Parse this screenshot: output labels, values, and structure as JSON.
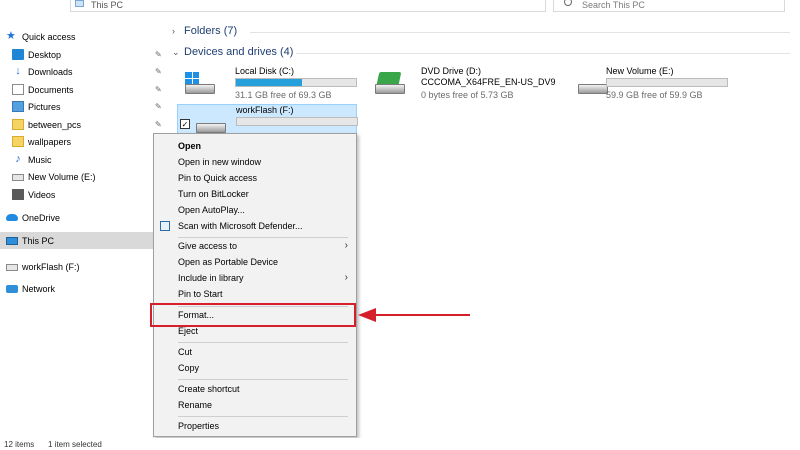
{
  "address": {
    "path": "This PC"
  },
  "search": {
    "placeholder": "Search This PC"
  },
  "nav": {
    "items": [
      {
        "label": "Quick access",
        "icon": "star-icon",
        "pinned": false
      },
      {
        "label": "Desktop",
        "icon": "desktop-icon",
        "pinned": true
      },
      {
        "label": "Downloads",
        "icon": "download-icon",
        "pinned": true
      },
      {
        "label": "Documents",
        "icon": "document-icon",
        "pinned": true
      },
      {
        "label": "Pictures",
        "icon": "pictures-icon",
        "pinned": true
      },
      {
        "label": "between_pcs",
        "icon": "folder-icon",
        "pinned": true
      },
      {
        "label": "wallpapers",
        "icon": "folder-icon",
        "pinned": false
      },
      {
        "label": "Music",
        "icon": "music-icon",
        "pinned": false
      },
      {
        "label": "New Volume (E:)",
        "icon": "drive-icon",
        "pinned": false
      },
      {
        "label": "Videos",
        "icon": "video-icon",
        "pinned": false
      },
      {
        "label": "OneDrive",
        "icon": "cloud-icon",
        "pinned": false
      },
      {
        "label": "This PC",
        "icon": "computer-icon",
        "pinned": false
      },
      {
        "label": "workFlash (F:)",
        "icon": "usb-drive-icon",
        "pinned": false
      },
      {
        "label": "Network",
        "icon": "network-icon",
        "pinned": false
      }
    ]
  },
  "content": {
    "folders_header": "Folders (7)",
    "devices_header": "Devices and drives (4)",
    "drives": [
      {
        "name": "Local Disk (C:)",
        "free": "31.1 GB free of 69.3 GB",
        "used_fraction": 0.55
      },
      {
        "name": "DVD Drive (D:)",
        "label2": "CCCOMA_X64FRE_EN-US_DV9",
        "free": "0 bytes free of 5.73 GB"
      },
      {
        "name": "New Volume (E:)",
        "free": "59.9 GB free of 59.9 GB",
        "used_fraction": 0.0
      },
      {
        "name": "workFlash (F:)",
        "free": "",
        "used_fraction": 0.0
      }
    ]
  },
  "context_menu": {
    "items": [
      {
        "label": "Open",
        "bold": true
      },
      {
        "label": "Open in new window"
      },
      {
        "label": "Pin to Quick access"
      },
      {
        "label": "Turn on BitLocker"
      },
      {
        "label": "Open AutoPlay..."
      },
      {
        "label": "Scan with Microsoft Defender..."
      },
      {
        "label": "Give access to",
        "submenu": true
      },
      {
        "label": "Open as Portable Device"
      },
      {
        "label": "Include in library",
        "submenu": true
      },
      {
        "label": "Pin to Start"
      },
      {
        "label": "Format..."
      },
      {
        "label": "Eject"
      },
      {
        "label": "Cut"
      },
      {
        "label": "Copy"
      },
      {
        "label": "Create shortcut"
      },
      {
        "label": "Rename"
      },
      {
        "label": "Properties"
      }
    ]
  },
  "status": {
    "count": "12 items",
    "selected": "1 item selected"
  },
  "colors": {
    "highlight": "#d51f2b",
    "selection": "#cce8ff",
    "accent": "#26a0da"
  }
}
